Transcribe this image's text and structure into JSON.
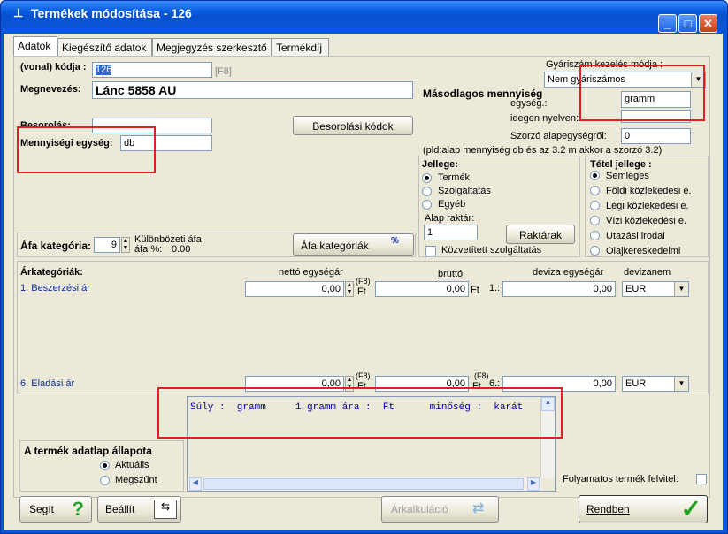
{
  "window": {
    "title": "Termékek módosítása - 126",
    "min": "_",
    "max": "□",
    "close": "✕"
  },
  "tabs": [
    "Adatok",
    "Kiegészítő adatok",
    "Megjegyzés szerkesztő",
    "Termékdíj"
  ],
  "fields": {
    "kod_label": "(vonal) kódja :",
    "kod_value": "126",
    "kod_hint": "[F8]",
    "megnevezes_label": "Megnevezés:",
    "megnevezes_value": "Lánc 5858 AU",
    "besorolas_label": "Besorolás:",
    "besorolas_value": "",
    "besorolasi_btn": "Besorolási kódok",
    "mennyisegi_label": "Mennyiségi egység:",
    "mennyisegi_value": "db"
  },
  "gyariszam": {
    "label": "Gyáriszám kezelés módja :",
    "value": "Nem gyáriszámos"
  },
  "masodlagos": {
    "title": "Másodlagos mennyiség",
    "egyseg_label": "egység.:",
    "egyseg_value": "gramm",
    "idegen_label": "idegen nyelven:",
    "idegen_value": "",
    "szorzo_label": "Szorzó alapegységről:",
    "szorzo_value": "0",
    "note": "(pld:alap mennyiség db és az 3.2 m akkor a szorzó 3.2)"
  },
  "jellege": {
    "title": "Jellege:",
    "options": [
      "Termék",
      "Szolgáltatás",
      "Egyéb"
    ],
    "selected": 0,
    "alap_raktar_label": "Alap raktár:",
    "alap_raktar_value": "1",
    "raktarak_btn": "Raktárak",
    "kozvetitett": "Közvetített szolgáltatás"
  },
  "tetel": {
    "title": "Tétel jellege :",
    "options": [
      "Semleges",
      "Földi közlekedési e.",
      "Légi közlekedési e.",
      "Vízi közlekedési e.",
      "Utazási irodai",
      "Olajkereskedelmi"
    ],
    "selected": 0
  },
  "afa": {
    "label": "Áfa kategória:",
    "value": "9",
    "kul1": "Különbözeti áfa",
    "kul2": "áfa %:",
    "kul_val": "0.00",
    "btn": "Áfa kategóriák"
  },
  "ar": {
    "title": "Árkategóriák:",
    "h_netto": "nettó egységár",
    "h_brutto": "bruttó",
    "h_deviza": "deviza egységár",
    "h_devizanem": "devizanem",
    "f8": "(F8)",
    "ft": "Ft",
    "row1": {
      "label": "1. Beszerzési ár",
      "netto": "0,00",
      "brutto": "0,00",
      "idx": "1.:",
      "deviza": "0,00",
      "devizanem": "EUR"
    },
    "row6": {
      "label": "6. Eladási ár",
      "netto": "0,00",
      "brutto": "0,00",
      "idx": "6.:",
      "deviza": "0,00",
      "devizanem": "EUR"
    }
  },
  "memo": {
    "line": "Súly :  gramm     1 gramm ára :  Ft      minőség :  karát"
  },
  "allapot": {
    "title": "A termék adatlap állapota",
    "options": [
      "Aktuális",
      "Megszűnt"
    ],
    "selected": 0
  },
  "folyamatos": "Folyamatos termék felvitel:",
  "buttons": {
    "segit": "Segít",
    "beallit": "Beállít",
    "arkalkulacio": "Árkalkuláció",
    "rendben": "Rendben"
  }
}
